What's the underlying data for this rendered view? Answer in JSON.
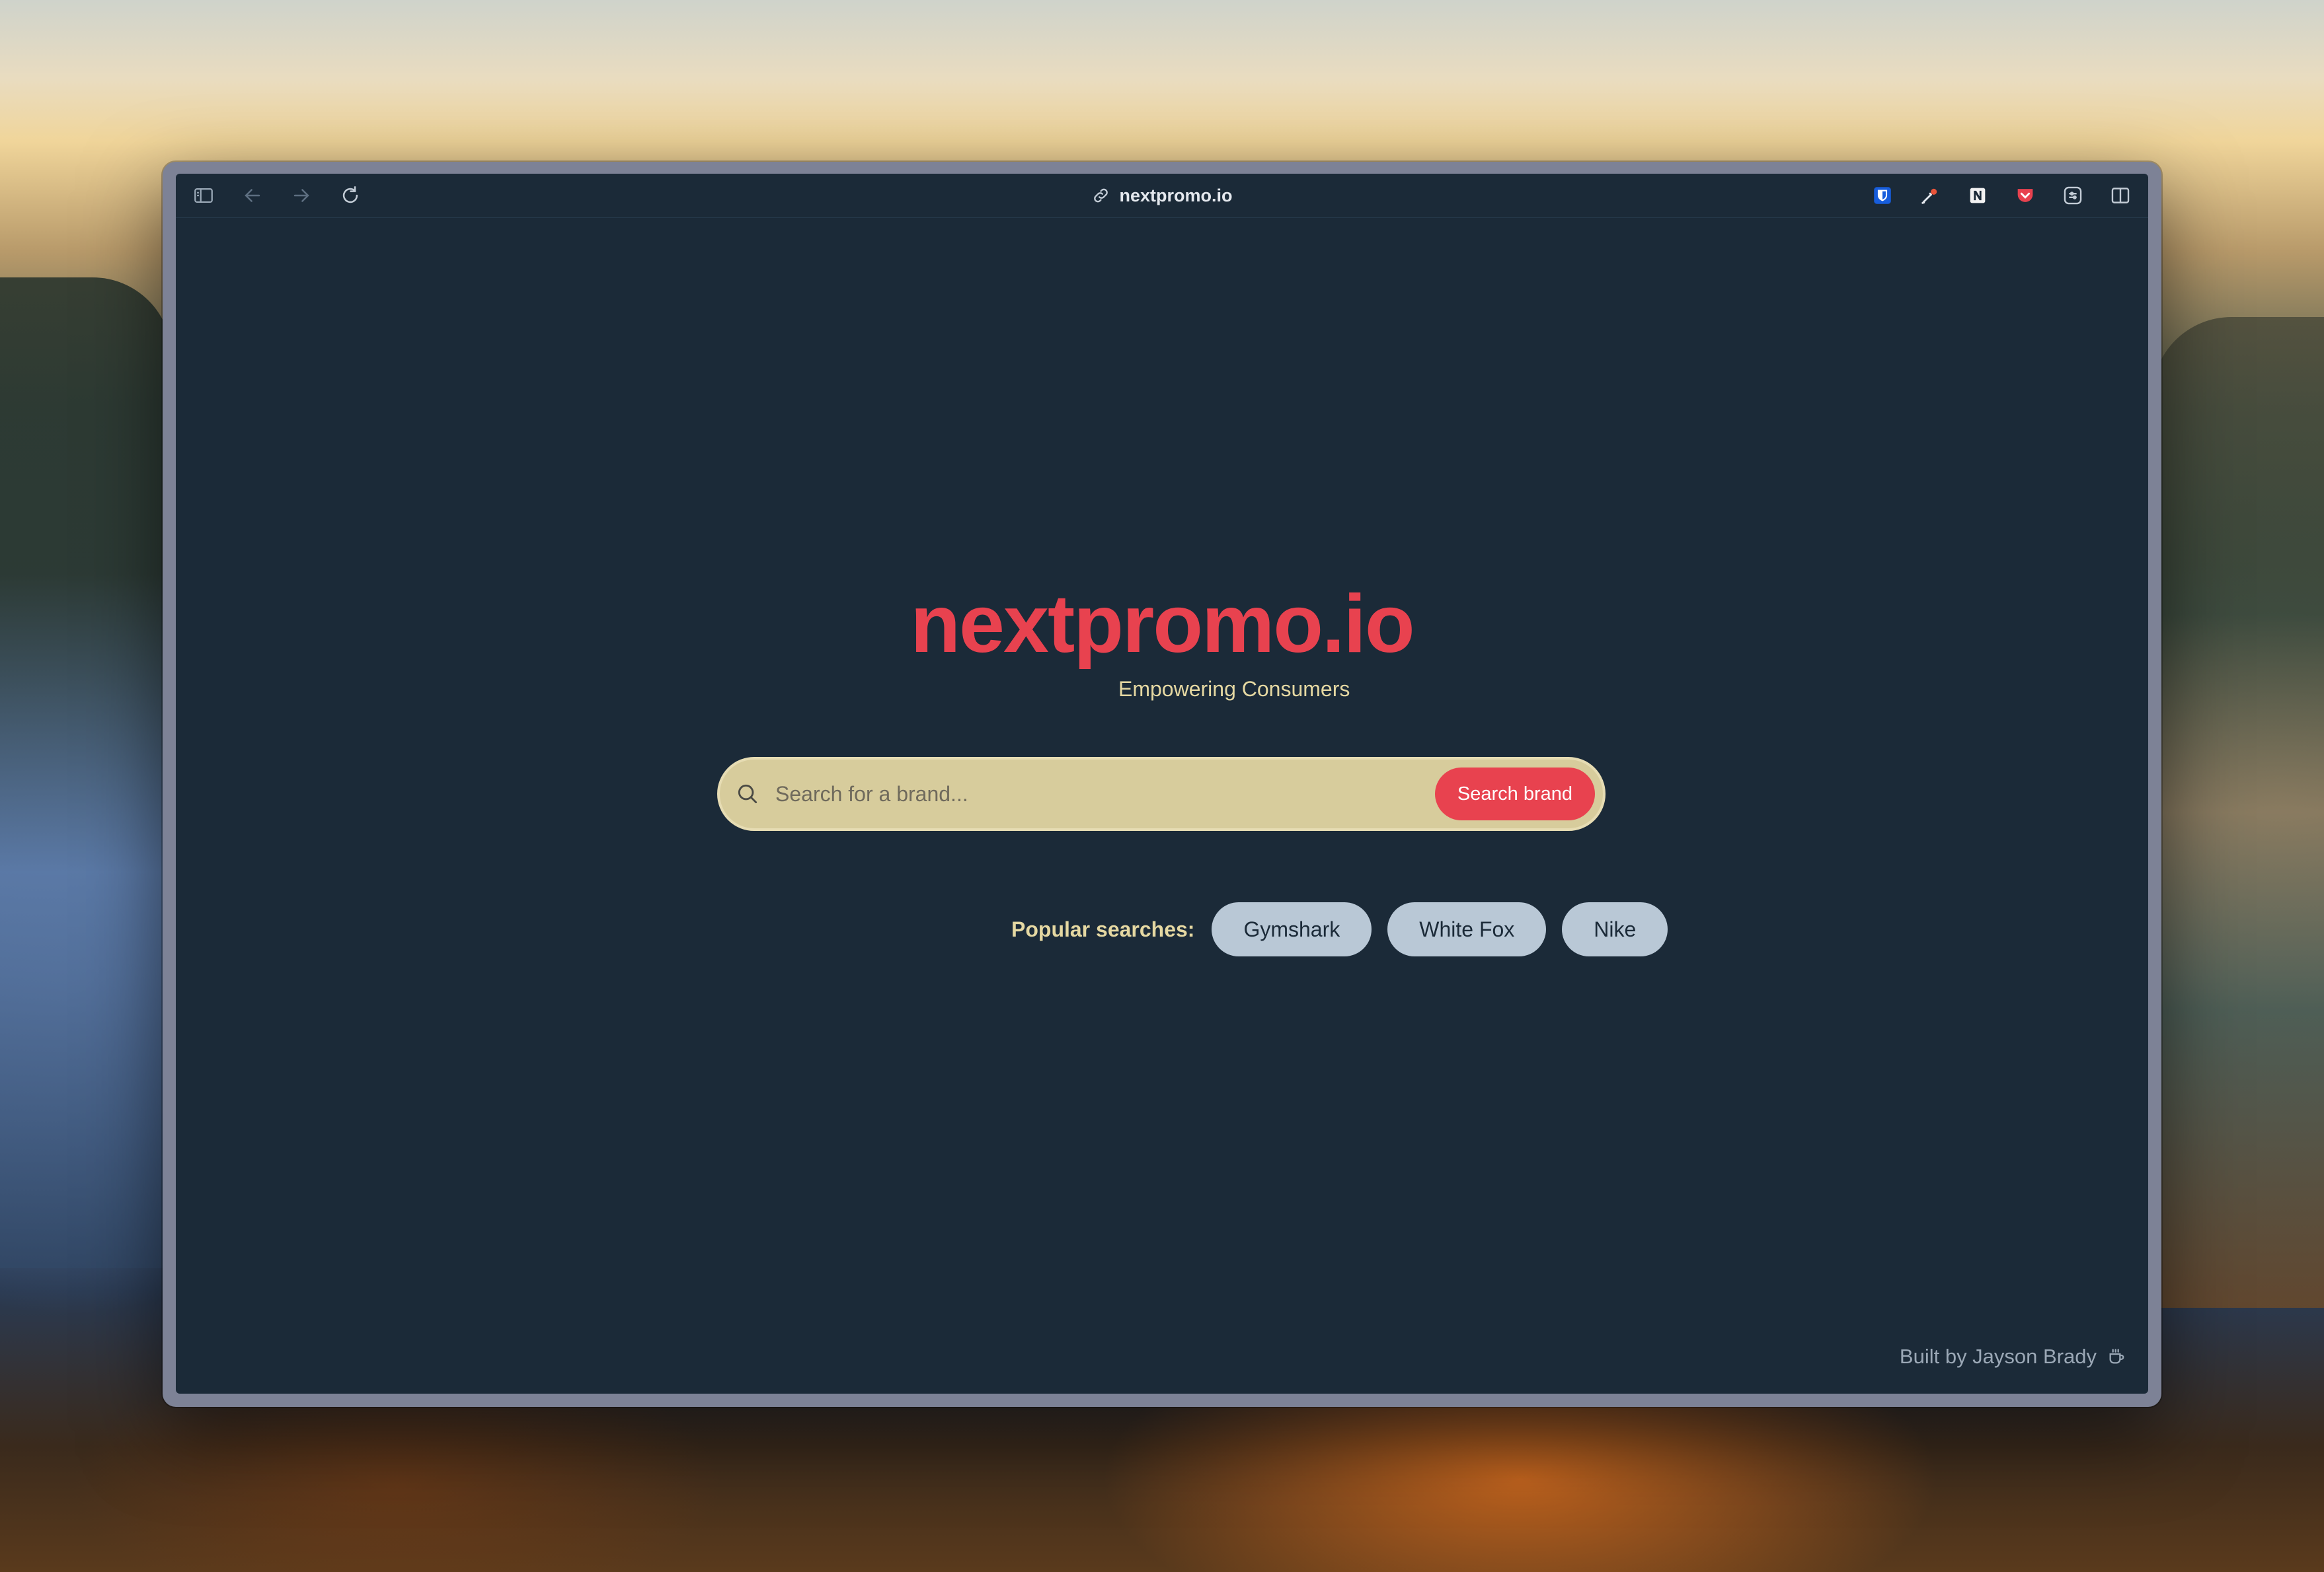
{
  "browser": {
    "address": "nextpromo.io",
    "toolbar_icons_left": [
      "sidebar-icon",
      "back-arrow-icon",
      "forward-arrow-icon",
      "reload-icon"
    ],
    "toolbar_icons_right": [
      "bitwarden-icon",
      "color-picker-icon",
      "notion-icon",
      "pocket-icon",
      "tab-manager-icon",
      "split-view-icon"
    ],
    "colors": {
      "window_frame": "#7d8296",
      "page_background": "#1b2a38"
    }
  },
  "page": {
    "title": "nextpromo.io",
    "tagline": "Empowering Consumers",
    "search": {
      "placeholder": "Search for a brand...",
      "value": "",
      "button_label": "Search brand"
    },
    "popular": {
      "label": "Popular searches:",
      "items": [
        "Gymshark",
        "White Fox",
        "Nike"
      ]
    },
    "footer": {
      "text": "Built by Jayson Brady",
      "icon": "coffee-cup-icon"
    },
    "colors": {
      "accent": "#e8424f",
      "cream": "#e5d8a2",
      "search_background": "#d7cc9c",
      "chip_background": "#b9c8d6"
    }
  }
}
